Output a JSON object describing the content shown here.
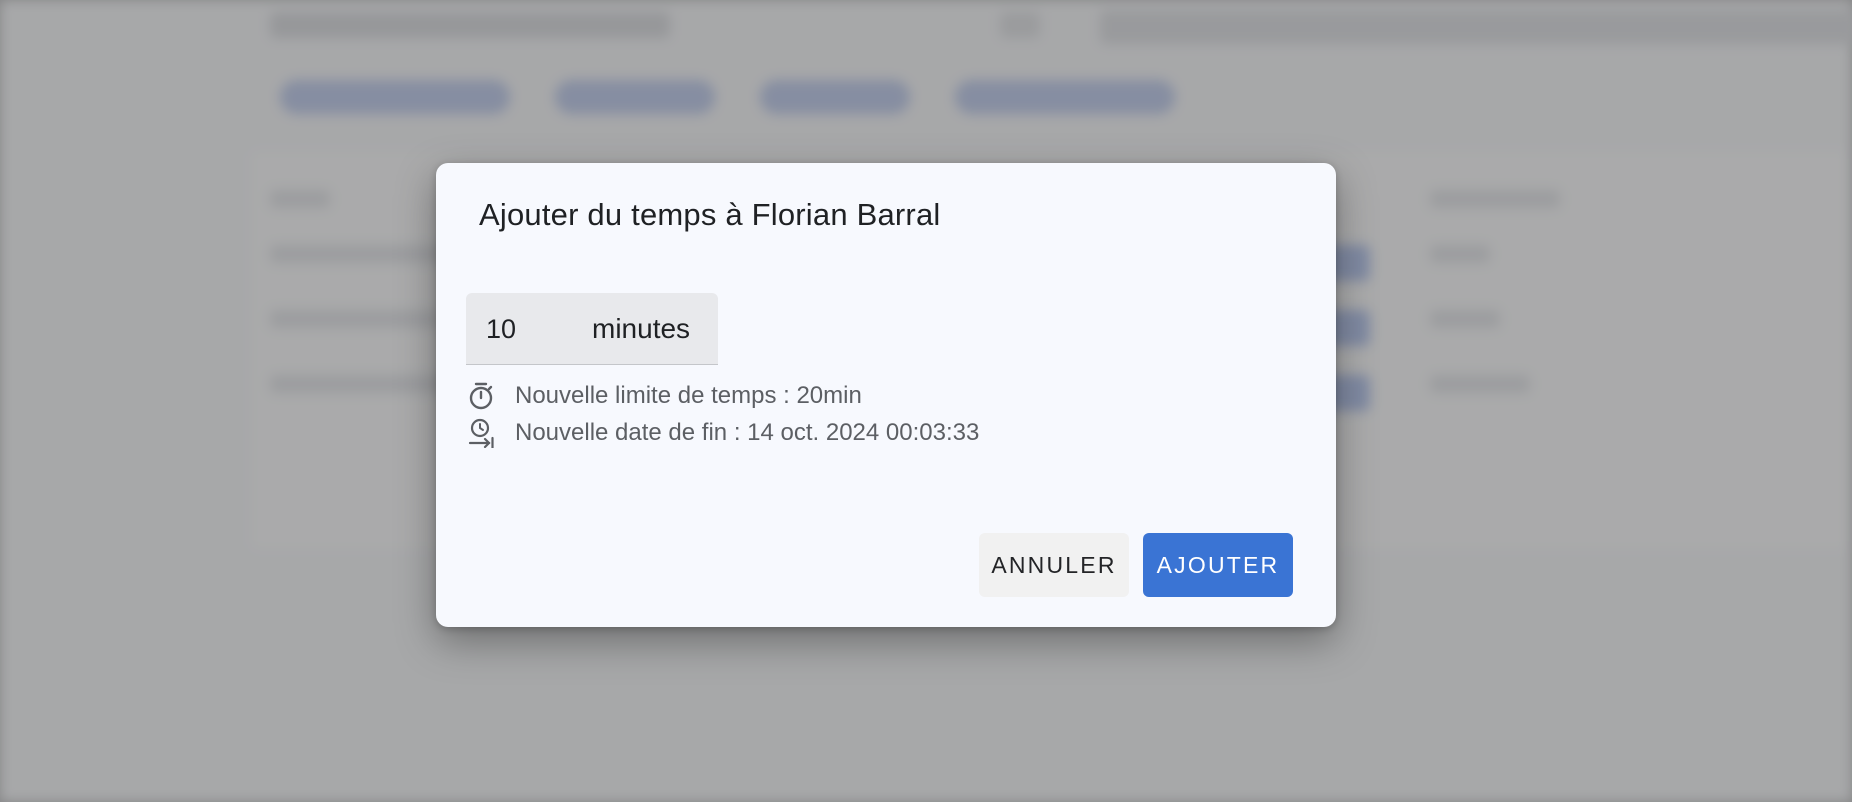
{
  "dialog": {
    "title": "Ajouter du temps à Florian Barral",
    "duration": {
      "value": "10",
      "suffix": "minutes"
    },
    "info": {
      "new_limit": "Nouvelle limite de temps : 20min",
      "new_end_date": "Nouvelle date de fin : 14 oct. 2024 00:03:33"
    },
    "buttons": {
      "cancel": "ANNULER",
      "add": "AJOUTER"
    }
  },
  "colors": {
    "primary": "#3a74d4",
    "dialog_background": "#f7f9fe",
    "overlay": "#787878"
  },
  "icons": {
    "limit": "timer-icon",
    "end_date": "schedule-send-icon"
  }
}
